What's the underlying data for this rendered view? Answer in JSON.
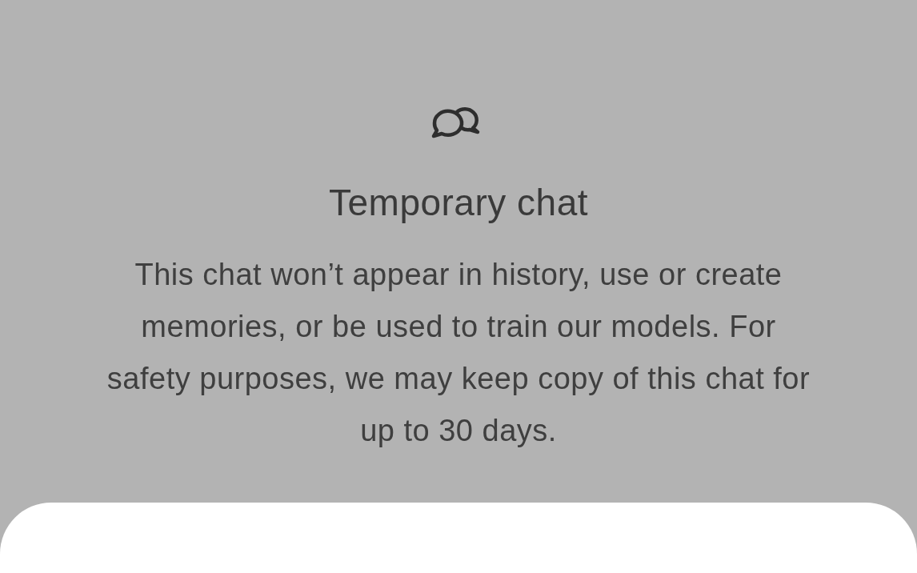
{
  "title": "Temporary chat",
  "description": "This chat won’t appear in history, use or create memories, or be used to train our models. For safety purposes, we may keep copy of this chat for up to 30 days."
}
